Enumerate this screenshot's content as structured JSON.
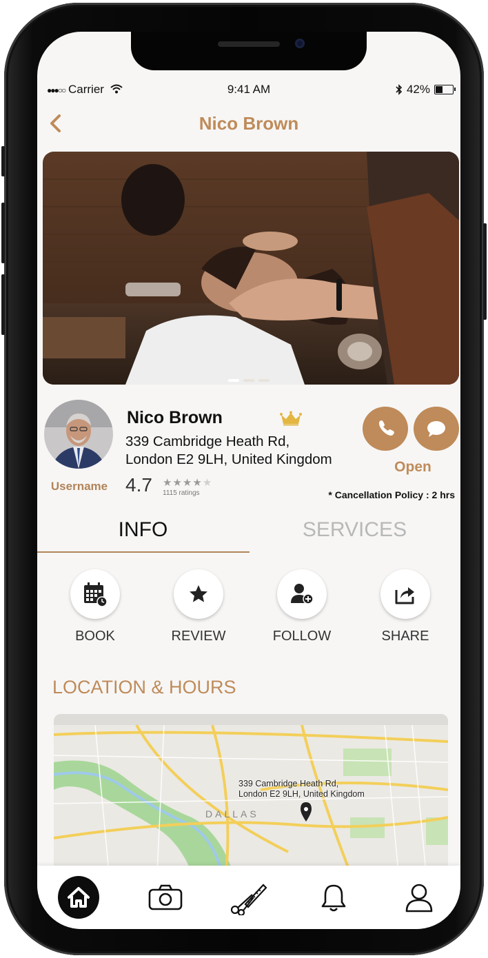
{
  "status_bar": {
    "carrier": "Carrier",
    "signal": "●●●○○",
    "time": "9:41 AM",
    "battery": "42%",
    "battery_level": 0.42
  },
  "header": {
    "title": "Nico Brown"
  },
  "profile": {
    "username_label": "Username",
    "name": "Nico Brown",
    "address_line1": "339 Cambridge Heath Rd,",
    "address_line2": "London E2 9LH, United Kingdom",
    "rating": "4.7",
    "stars_filled": 4,
    "stars_total": 5,
    "ratings_count": "1115 ratings",
    "status": "Open",
    "cancellation_policy": "* Cancellation Policy : 2 hrs"
  },
  "tabs": [
    {
      "label": "INFO"
    },
    {
      "label": "SERVICES"
    }
  ],
  "actions": [
    {
      "label": "BOOK",
      "icon": "calendar-icon"
    },
    {
      "label": "REVIEW",
      "icon": "star-icon"
    },
    {
      "label": "FOLLOW",
      "icon": "add-user-icon"
    },
    {
      "label": "SHARE",
      "icon": "share-icon"
    }
  ],
  "location": {
    "section_title": "LOCATION & HOURS",
    "map_label_line1": "339 Cambridge Heath Rd,",
    "map_label_line2": "London E2 9LH, United Kingdom",
    "map_city": "DALLAS"
  },
  "bottom_nav": [
    {
      "icon": "home-icon"
    },
    {
      "icon": "camera-icon"
    },
    {
      "icon": "scissors-comb-icon"
    },
    {
      "icon": "bell-icon"
    },
    {
      "icon": "profile-icon"
    }
  ],
  "colors": {
    "accent": "#bf8b5a",
    "text": "#111111",
    "muted": "#b8b8b8"
  }
}
